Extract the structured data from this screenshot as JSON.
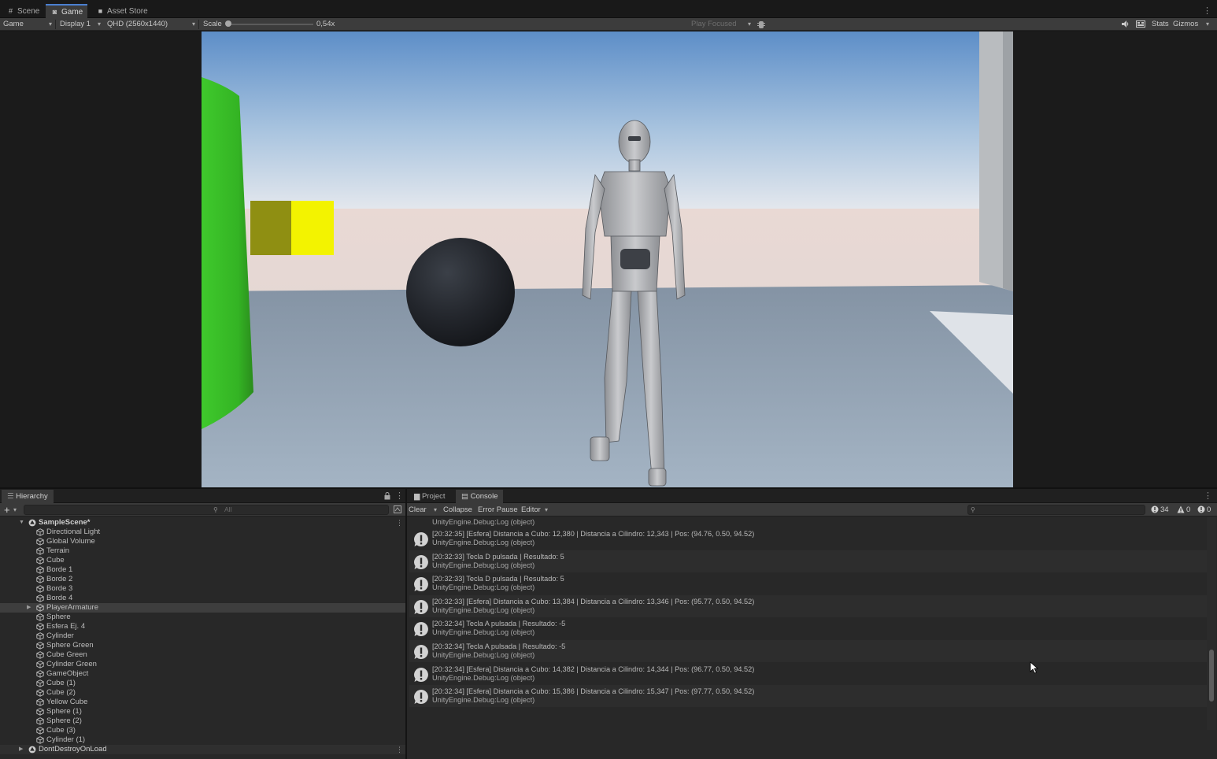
{
  "tabs": [
    {
      "label": "Scene",
      "icon": "grid-icon"
    },
    {
      "label": "Game",
      "icon": "gamepad-icon"
    },
    {
      "label": "Asset Store",
      "icon": "shopping-bag-icon"
    }
  ],
  "game_toolbar": {
    "view_mode": "Game",
    "display": "Display 1",
    "resolution": "QHD (2560x1440)",
    "scale_label": "Scale",
    "scale_value": "0,54x",
    "play_mode": "Play Focused",
    "stats_label": "Stats",
    "gizmos_label": "Gizmos"
  },
  "hierarchy": {
    "title": "Hierarchy",
    "search_placeholder": "All",
    "scene_name": "SampleScene*",
    "items": [
      "Directional Light",
      "Global Volume",
      "Terrain",
      "Cube",
      "Borde 1",
      "Borde 2",
      "Borde 3",
      "Borde 4",
      "PlayerArmature",
      "Sphere",
      "Esfera Ej. 4",
      "Cylinder",
      "Sphere Green",
      "Cube Green",
      "Cylinder Green",
      "GameObject",
      "Cube (1)",
      "Cube (2)",
      "Yellow Cube",
      "Sphere (1)",
      "Sphere (2)",
      "Cube (3)",
      "Cylinder (1)"
    ],
    "selected_index": 8,
    "dont_destroy": "DontDestroyOnLoad"
  },
  "console": {
    "tab_project": "Project",
    "tab_console": "Console",
    "clear_label": "Clear",
    "collapse_label": "Collapse",
    "error_pause_label": "Error Pause",
    "editor_label": "Editor",
    "log_count": "34",
    "warn_count": "0",
    "error_count": "0",
    "entries": [
      {
        "message": "[20:32:35] [Esfera] Distancia a Cubo: 12,380 | Distancia a Cilindro: 12,343 | Pos: (94.76, 0.50, 94.52)",
        "source": "UnityEngine.Debug:Log (object)"
      },
      {
        "message": "[20:32:33] Tecla D pulsada | Resultado: 5",
        "source": "UnityEngine.Debug:Log (object)"
      },
      {
        "message": "[20:32:33] Tecla D pulsada | Resultado: 5",
        "source": "UnityEngine.Debug:Log (object)"
      },
      {
        "message": "[20:32:33] [Esfera] Distancia a Cubo: 13,384 | Distancia a Cilindro: 13,346 | Pos: (95.77, 0.50, 94.52)",
        "source": "UnityEngine.Debug:Log (object)"
      },
      {
        "message": "[20:32:34] Tecla A pulsada | Resultado: -5",
        "source": "UnityEngine.Debug:Log (object)"
      },
      {
        "message": "[20:32:34] Tecla A pulsada | Resultado: -5",
        "source": "UnityEngine.Debug:Log (object)"
      },
      {
        "message": "[20:32:34] [Esfera] Distancia a Cubo: 14,382 | Distancia a Cilindro: 14,344 | Pos: (96.77, 0.50, 94.52)",
        "source": "UnityEngine.Debug:Log (object)"
      },
      {
        "message": "[20:32:34] [Esfera] Distancia a Cubo: 15,386 | Distancia a Cilindro: 15,347 | Pos: (97.77, 0.50, 94.52)",
        "source": "UnityEngine.Debug:Log (object)"
      }
    ],
    "partial_top_source": "UnityEngine.Debug:Log (object)"
  },
  "colors": {
    "accent": "#4a7fd0",
    "green_object": "#3dc42a",
    "yellow_object": "#f2f200",
    "sphere": "#24272d"
  }
}
